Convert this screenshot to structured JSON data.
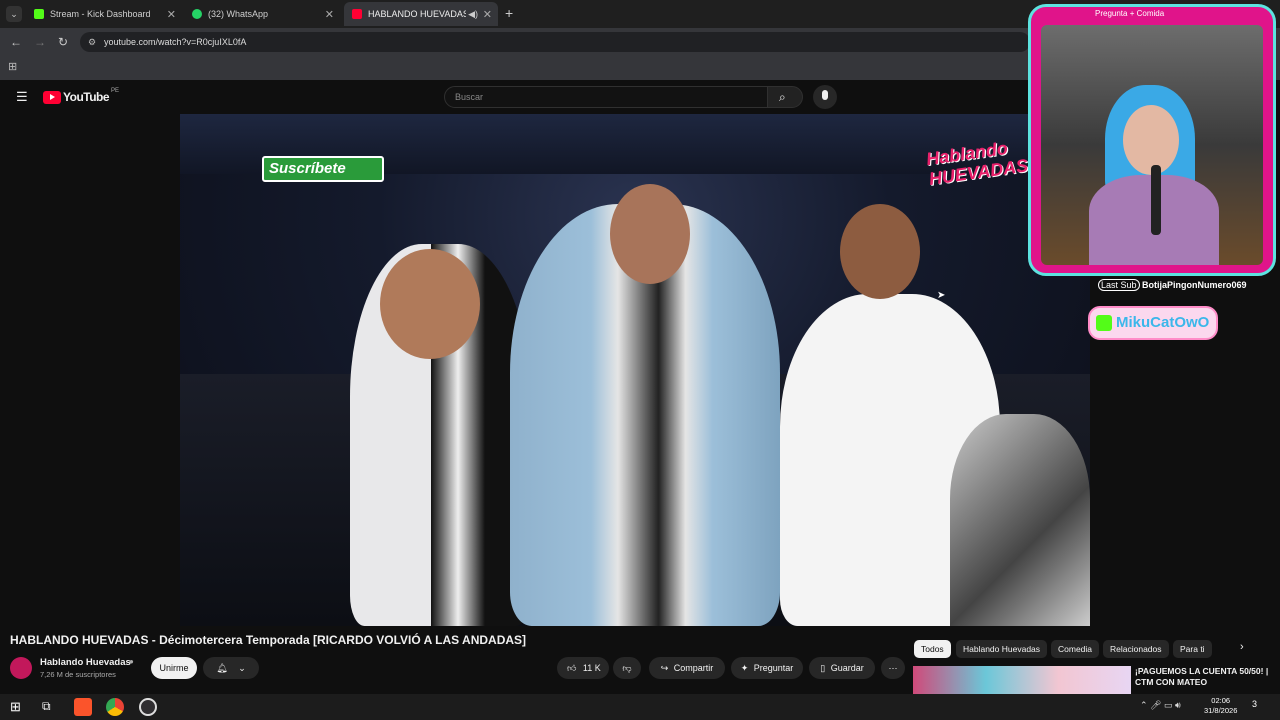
{
  "browser": {
    "tabs": [
      {
        "title": "Stream - Kick Dashboard",
        "color": "#53fc18"
      },
      {
        "title": "(32) WhatsApp",
        "color": "#25d366"
      },
      {
        "title": "HABLANDO HUEVADAS - D",
        "color": "#ff0033"
      }
    ],
    "url": "youtube.com/watch?v=R0cjuIXL0fA",
    "new_tab": "+"
  },
  "youtube": {
    "logo_text": "YouTube",
    "region": "PE",
    "search_placeholder": "Buscar",
    "subscribe_overlay": "Suscríbete",
    "watermark_line1": "Hablando",
    "watermark_line2": "HUEVADAS",
    "video_title": "HABLANDO HUEVADAS - Décimotercera Temporada [RICARDO VOLVIÓ A LAS ANDADAS]",
    "channel_name": "Hablando Huevadas",
    "subscribers": "7,26 M de suscriptores",
    "join_label": "Unirme",
    "like_count": "11 K",
    "share_label": "Compartir",
    "ask_label": "Preguntar",
    "save_label": "Guardar",
    "chips": [
      "Todos",
      "Hablando Huevadas",
      "Comedia",
      "Relacionados",
      "Para ti"
    ],
    "rec_title_1": "¡PAGUEMOS LA CUENTA 50/50! |",
    "rec_title_2": "CTM CON MATEO"
  },
  "overlay": {
    "top_text": "Pregunta + Comida",
    "last_sub_label": "Last Sub",
    "last_sub_name": "BotijaPingonNumero069",
    "streamer_name": "MikuCatOwO"
  },
  "taskbar": {
    "time": "02:06",
    "date": "31/8/2026",
    "notifications": "3"
  }
}
